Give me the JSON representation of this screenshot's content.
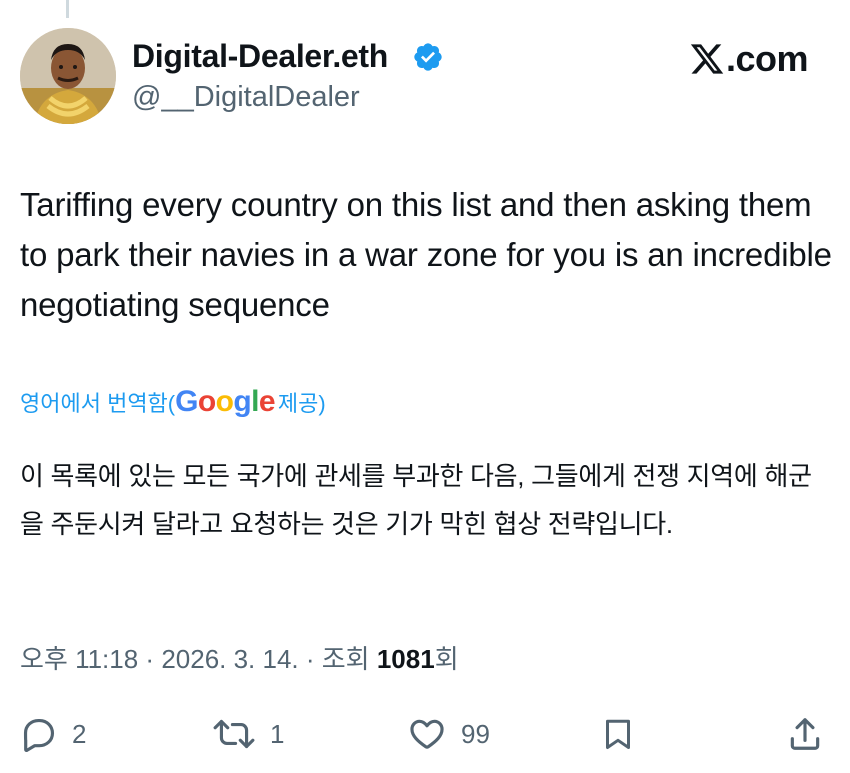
{
  "author": {
    "display_name": "Digital-Dealer.eth",
    "handle": "@__DigitalDealer",
    "verified_icon": "verified-badge-icon"
  },
  "brand": {
    "label": ".com",
    "icon": "x-logo-icon"
  },
  "tweet": {
    "text": "Tariffing every country on this list and then asking them to park their navies in a war zone for you is an incredible negotiating sequence"
  },
  "translation": {
    "label": "영어에서 번역함(",
    "provider": {
      "g1": "G",
      "o1": "o",
      "o2": "o",
      "g2": "g",
      "l": "l",
      "e": "e"
    },
    "suffix": " 제공)",
    "text": "이 목록에 있는 모든 국가에 관세를 부과한 다음, 그들에게 전쟁 지역에 해군을 주둔시켜 달라고 요청하는 것은 기가 막힌 협상 전략입니다."
  },
  "meta": {
    "time": "오후 11:18",
    "separator": " · ",
    "date": "2026. 3. 14.",
    "separator2": " · ",
    "views_label": "조회 ",
    "views_count": "1081",
    "views_suffix": "회"
  },
  "actions": {
    "reply": {
      "icon": "reply-icon",
      "count": "2"
    },
    "repost": {
      "icon": "repost-icon",
      "count": "1"
    },
    "like": {
      "icon": "heart-icon",
      "count": "99"
    },
    "bookmark": {
      "icon": "bookmark-icon"
    },
    "share": {
      "icon": "share-icon"
    }
  },
  "colors": {
    "text": "#0f1419",
    "secondary": "#536471",
    "link": "#1d9bf0",
    "verified": "#1d9bf0"
  }
}
